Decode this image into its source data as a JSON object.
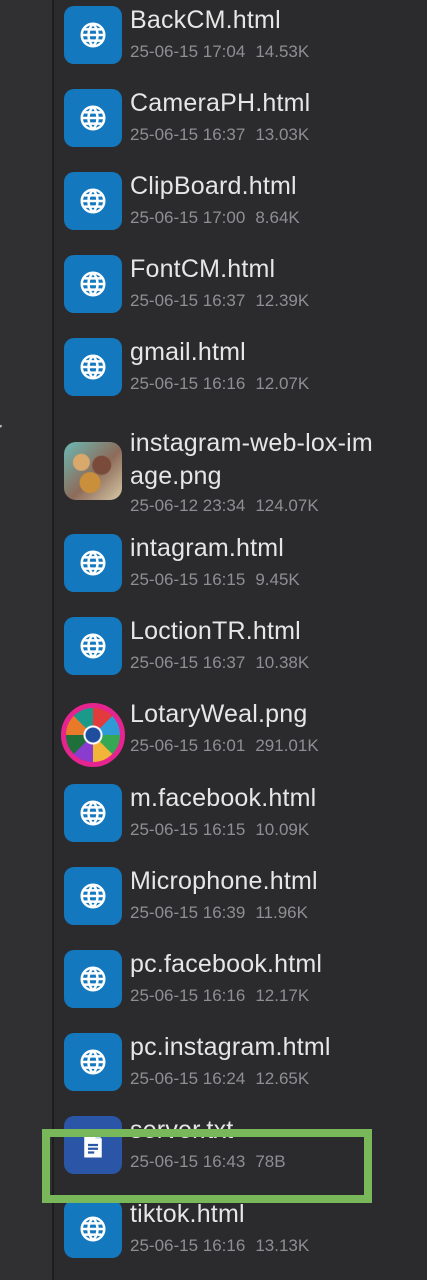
{
  "colors": {
    "background": "#2b2b2d",
    "web_icon": "#1478be",
    "doc_icon": "#2b56a7",
    "name_text": "#e6e6e6",
    "meta_text": "#8f8f93",
    "highlight": "#79b85a"
  },
  "files": [
    {
      "name": "BackCM.html",
      "date": "25-06-15 17:04",
      "size": "14.53K",
      "icon": "globe-icon"
    },
    {
      "name": "CameraPH.html",
      "date": "25-06-15 16:37",
      "size": "13.03K",
      "icon": "globe-icon"
    },
    {
      "name": "ClipBoard.html",
      "date": "25-06-15 17:00",
      "size": "8.64K",
      "icon": "globe-icon"
    },
    {
      "name": "FontCM.html",
      "date": "25-06-15 16:37",
      "size": "12.39K",
      "icon": "globe-icon"
    },
    {
      "name": "gmail.html",
      "date": "25-06-15 16:16",
      "size": "12.07K",
      "icon": "globe-icon"
    },
    {
      "name": "instagram-web-lox-image.png",
      "name_line1": "instagram-web-lox-im",
      "name_line2": "age.png",
      "date": "25-06-12 23:34",
      "size": "124.07K",
      "icon": "image-thumbnail"
    },
    {
      "name": "intagram.html",
      "date": "25-06-15 16:15",
      "size": "9.45K",
      "icon": "globe-icon"
    },
    {
      "name": "LoctionTR.html",
      "date": "25-06-15 16:37",
      "size": "10.38K",
      "icon": "globe-icon"
    },
    {
      "name": "LotaryWeal.png",
      "date": "25-06-15 16:01",
      "size": "291.01K",
      "icon": "image-thumbnail"
    },
    {
      "name": "m.facebook.html",
      "date": "25-06-15 16:15",
      "size": "10.09K",
      "icon": "globe-icon"
    },
    {
      "name": "Microphone.html",
      "date": "25-06-15 16:39",
      "size": "11.96K",
      "icon": "globe-icon"
    },
    {
      "name": "pc.facebook.html",
      "date": "25-06-15 16:16",
      "size": "12.17K",
      "icon": "globe-icon"
    },
    {
      "name": "pc.instagram.html",
      "date": "25-06-15 16:24",
      "size": "12.65K",
      "icon": "globe-icon"
    },
    {
      "name": "server.txt",
      "date": "25-06-15 16:43",
      "size": "78B",
      "icon": "document-icon"
    },
    {
      "name": "tiktok.html",
      "date": "25-06-15 16:16",
      "size": "13.13K",
      "icon": "globe-icon"
    }
  ]
}
